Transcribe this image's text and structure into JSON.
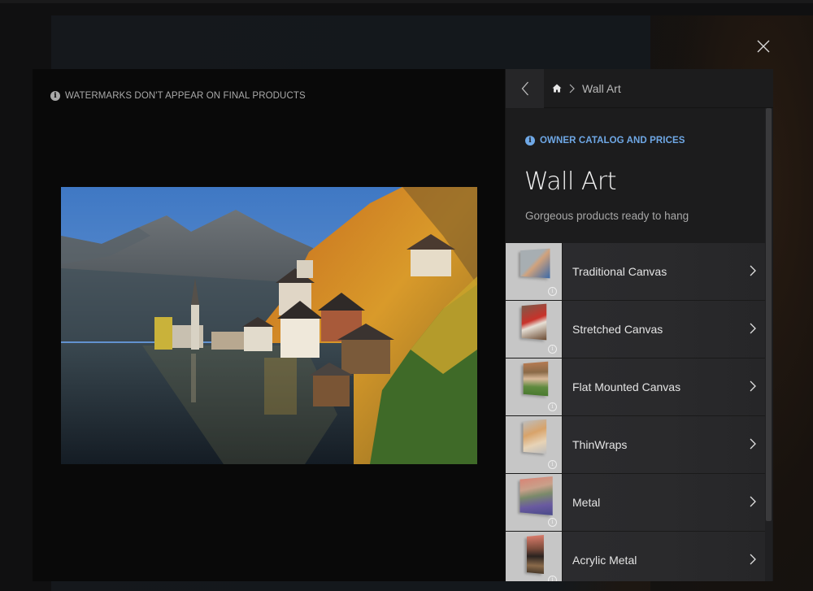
{
  "modal": {
    "close_label": "Close",
    "watermark_notice": "WATERMARKS DON'T APPEAR ON FINAL PRODUCTS",
    "photo_description": "Lakeside alpine village with church spire, autumn foliage and mountains"
  },
  "nav": {
    "back_label": "Back",
    "breadcrumb": [
      {
        "icon": "home-icon",
        "label": ""
      },
      {
        "label": "Wall Art"
      }
    ]
  },
  "catalog": {
    "owner_notice": "OWNER CATALOG AND PRICES",
    "title": "Wall Art",
    "subtitle": "Gorgeous products ready to hang"
  },
  "products": [
    {
      "label": "Traditional Canvas",
      "thumb_colors": [
        "#9aa3a8",
        "#c9a27a"
      ]
    },
    {
      "label": "Stretched Canvas",
      "thumb_colors": [
        "#7a4a3a",
        "#c9372c"
      ]
    },
    {
      "label": "Flat Mounted Canvas",
      "thumb_colors": [
        "#6a8a4a",
        "#b77d57"
      ]
    },
    {
      "label": "ThinWraps",
      "thumb_colors": [
        "#bfbfbf",
        "#d9a26a"
      ]
    },
    {
      "label": "Metal",
      "thumb_colors": [
        "#d7867a",
        "#6a5aa0"
      ]
    },
    {
      "label": "Acrylic Metal",
      "thumb_colors": [
        "#d77a6a",
        "#3a2a22"
      ]
    }
  ],
  "colors": {
    "accent_info": "#6fa8e6"
  }
}
